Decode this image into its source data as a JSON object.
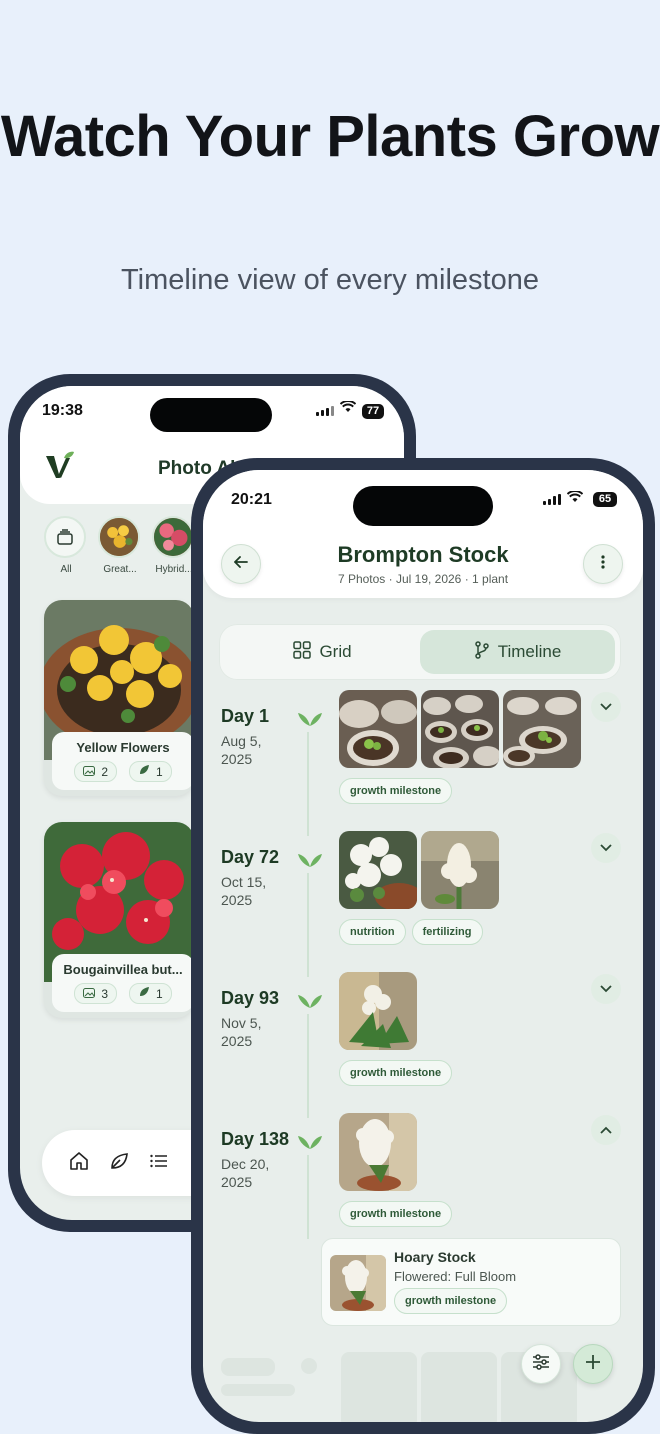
{
  "hero": {
    "title": "Watch Your Plants Grow",
    "subtitle": "Timeline view of every milestone"
  },
  "back_phone": {
    "status": {
      "time": "19:38",
      "battery": "77"
    },
    "header_title": "Photo Al",
    "filters": [
      {
        "label": "All"
      },
      {
        "label": "Great..."
      },
      {
        "label": "Hybrid..."
      }
    ],
    "albums": [
      {
        "name": "Yellow Flowers",
        "photos": "2",
        "plants": "1"
      },
      {
        "name": "Bougainvillea but...",
        "photos": "3",
        "plants": "1"
      }
    ]
  },
  "front_phone": {
    "status": {
      "time": "20:21",
      "battery": "65"
    },
    "album": {
      "title": "Brompton Stock",
      "meta": "7 Photos  ·  Jul 19, 2026  ·  1 plant"
    },
    "segments": {
      "grid": "Grid",
      "timeline": "Timeline",
      "active": "timeline"
    },
    "entries": [
      {
        "day": "Day 1",
        "date": "Aug 5, 2025",
        "tags": [
          "growth milestone"
        ],
        "expanded": false
      },
      {
        "day": "Day 72",
        "date": "Oct 15, 2025",
        "tags": [
          "nutrition",
          "fertilizing"
        ],
        "expanded": false
      },
      {
        "day": "Day 93",
        "date": "Nov 5, 2025",
        "tags": [
          "growth milestone"
        ],
        "expanded": false
      },
      {
        "day": "Day 138",
        "date": "Dec 20, 2025",
        "tags": [
          "growth milestone"
        ],
        "expanded": true
      }
    ],
    "plant_card": {
      "name": "Hoary Stock",
      "status": "Flowered: Full Bloom",
      "tag": "growth milestone"
    }
  },
  "colors": {
    "background": "#e8f0fb",
    "accent_green": "#5a9a5e",
    "title_green": "#1e3b25"
  }
}
